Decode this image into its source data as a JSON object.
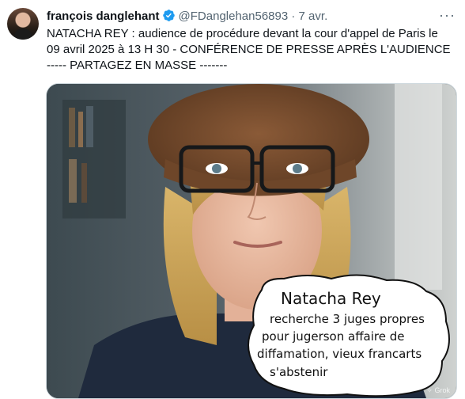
{
  "tweet": {
    "author_name": "françois danglehant",
    "author_handle": "@FDanglehan56893",
    "separator": "·",
    "date": "7 avr.",
    "more_label": "···",
    "text_lines": [
      "NATACHA REY : audience de procédure devant la cour d'appel de Paris le",
      "09 avril 2025 à 13 H 30 - CONFÉRENCE DE PRESSE APRÈS L'AUDIENCE",
      "----- PARTAGEZ EN MASSE -------"
    ]
  },
  "media": {
    "bubble_lines": [
      "Natacha Rey",
      "recherche  3 juges propres",
      "pour jugerson affaire de",
      "diffamation, vieux francarts",
      "s'abstenir"
    ],
    "watermark": "✧ Grok"
  },
  "colors": {
    "verified": "#1d9bf0",
    "secondary_text": "#536471",
    "border": "#cfd9de"
  },
  "icons": [
    "verified-badge-icon",
    "more-options-icon"
  ]
}
